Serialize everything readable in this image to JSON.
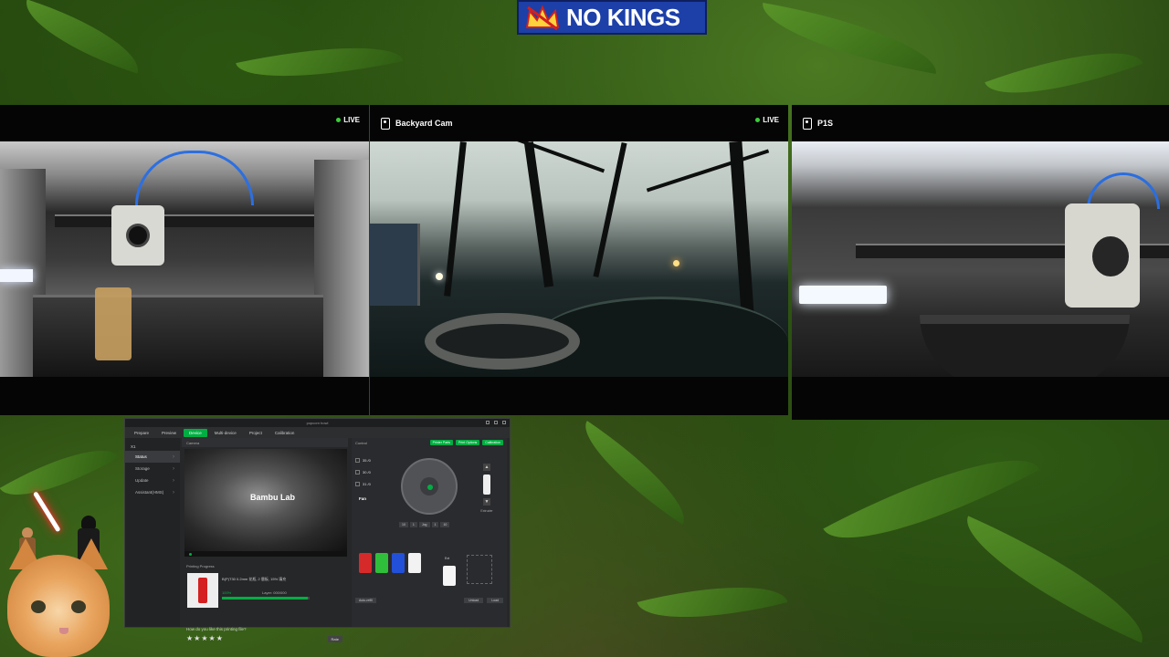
{
  "banner": {
    "text": "NO KINGS",
    "color": "#1d3fa8"
  },
  "cameras": [
    {
      "title": "",
      "live": "LIVE",
      "feed": "printer-chamber"
    },
    {
      "title": "Backyard Cam",
      "live": "LIVE",
      "feed": "backyard-night"
    },
    {
      "title": "P1S",
      "live": "",
      "feed": "printer-p1s"
    }
  ],
  "bambu": {
    "window_title": "popcorn bowl",
    "menu": [
      "Prepare",
      "Preview",
      "Device",
      "Multi-device",
      "Project",
      "Calibration"
    ],
    "active_tab": "Device",
    "printer": "X1",
    "sidebar": [
      "Status",
      "Storage",
      "Update",
      "Assistant(HMS)"
    ],
    "camera_label": "Camera",
    "video_logo": "Bambu Lab",
    "printing_progress": "Printing Progress",
    "file_info": "B(P)T30 0.2mm 花瓶, 2 層板, 15% 填充",
    "percent": "100%",
    "layer": "Layer: 000/000",
    "control_label": "Control",
    "control_buttons": [
      "Printer Parts",
      "Print Options",
      "Calibration"
    ],
    "temps": [
      "35 /0",
      "30 /0",
      "31 /0"
    ],
    "fan": "Fan",
    "axis_buttons": [
      "10",
      "1",
      "Jog",
      "1",
      "10"
    ],
    "extruder_label": "Extruder",
    "ext_label": "Ext",
    "bottom_left": "Auto-refill",
    "bottom_right": [
      "Unload",
      "Load"
    ],
    "feedback_question": "How do you like this printing file?",
    "stars": "★★★★★",
    "rate": "Rate",
    "ams_colors": [
      "#d62a2a",
      "#2fbf3a",
      "#2350d8",
      "#f2f2f2"
    ],
    "accent": "#00ae42"
  },
  "progress": {
    "fill_fraction": 0.98
  }
}
